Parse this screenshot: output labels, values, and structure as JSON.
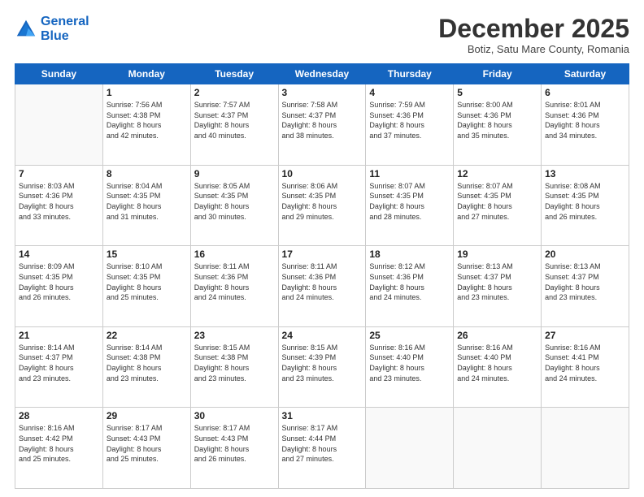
{
  "header": {
    "logo_line1": "General",
    "logo_line2": "Blue",
    "month": "December 2025",
    "location": "Botiz, Satu Mare County, Romania"
  },
  "weekdays": [
    "Sunday",
    "Monday",
    "Tuesday",
    "Wednesday",
    "Thursday",
    "Friday",
    "Saturday"
  ],
  "weeks": [
    [
      {
        "day": "",
        "info": ""
      },
      {
        "day": "1",
        "info": "Sunrise: 7:56 AM\nSunset: 4:38 PM\nDaylight: 8 hours\nand 42 minutes."
      },
      {
        "day": "2",
        "info": "Sunrise: 7:57 AM\nSunset: 4:37 PM\nDaylight: 8 hours\nand 40 minutes."
      },
      {
        "day": "3",
        "info": "Sunrise: 7:58 AM\nSunset: 4:37 PM\nDaylight: 8 hours\nand 38 minutes."
      },
      {
        "day": "4",
        "info": "Sunrise: 7:59 AM\nSunset: 4:36 PM\nDaylight: 8 hours\nand 37 minutes."
      },
      {
        "day": "5",
        "info": "Sunrise: 8:00 AM\nSunset: 4:36 PM\nDaylight: 8 hours\nand 35 minutes."
      },
      {
        "day": "6",
        "info": "Sunrise: 8:01 AM\nSunset: 4:36 PM\nDaylight: 8 hours\nand 34 minutes."
      }
    ],
    [
      {
        "day": "7",
        "info": "Sunrise: 8:03 AM\nSunset: 4:36 PM\nDaylight: 8 hours\nand 33 minutes."
      },
      {
        "day": "8",
        "info": "Sunrise: 8:04 AM\nSunset: 4:35 PM\nDaylight: 8 hours\nand 31 minutes."
      },
      {
        "day": "9",
        "info": "Sunrise: 8:05 AM\nSunset: 4:35 PM\nDaylight: 8 hours\nand 30 minutes."
      },
      {
        "day": "10",
        "info": "Sunrise: 8:06 AM\nSunset: 4:35 PM\nDaylight: 8 hours\nand 29 minutes."
      },
      {
        "day": "11",
        "info": "Sunrise: 8:07 AM\nSunset: 4:35 PM\nDaylight: 8 hours\nand 28 minutes."
      },
      {
        "day": "12",
        "info": "Sunrise: 8:07 AM\nSunset: 4:35 PM\nDaylight: 8 hours\nand 27 minutes."
      },
      {
        "day": "13",
        "info": "Sunrise: 8:08 AM\nSunset: 4:35 PM\nDaylight: 8 hours\nand 26 minutes."
      }
    ],
    [
      {
        "day": "14",
        "info": "Sunrise: 8:09 AM\nSunset: 4:35 PM\nDaylight: 8 hours\nand 26 minutes."
      },
      {
        "day": "15",
        "info": "Sunrise: 8:10 AM\nSunset: 4:35 PM\nDaylight: 8 hours\nand 25 minutes."
      },
      {
        "day": "16",
        "info": "Sunrise: 8:11 AM\nSunset: 4:36 PM\nDaylight: 8 hours\nand 24 minutes."
      },
      {
        "day": "17",
        "info": "Sunrise: 8:11 AM\nSunset: 4:36 PM\nDaylight: 8 hours\nand 24 minutes."
      },
      {
        "day": "18",
        "info": "Sunrise: 8:12 AM\nSunset: 4:36 PM\nDaylight: 8 hours\nand 24 minutes."
      },
      {
        "day": "19",
        "info": "Sunrise: 8:13 AM\nSunset: 4:37 PM\nDaylight: 8 hours\nand 23 minutes."
      },
      {
        "day": "20",
        "info": "Sunrise: 8:13 AM\nSunset: 4:37 PM\nDaylight: 8 hours\nand 23 minutes."
      }
    ],
    [
      {
        "day": "21",
        "info": "Sunrise: 8:14 AM\nSunset: 4:37 PM\nDaylight: 8 hours\nand 23 minutes."
      },
      {
        "day": "22",
        "info": "Sunrise: 8:14 AM\nSunset: 4:38 PM\nDaylight: 8 hours\nand 23 minutes."
      },
      {
        "day": "23",
        "info": "Sunrise: 8:15 AM\nSunset: 4:38 PM\nDaylight: 8 hours\nand 23 minutes."
      },
      {
        "day": "24",
        "info": "Sunrise: 8:15 AM\nSunset: 4:39 PM\nDaylight: 8 hours\nand 23 minutes."
      },
      {
        "day": "25",
        "info": "Sunrise: 8:16 AM\nSunset: 4:40 PM\nDaylight: 8 hours\nand 23 minutes."
      },
      {
        "day": "26",
        "info": "Sunrise: 8:16 AM\nSunset: 4:40 PM\nDaylight: 8 hours\nand 24 minutes."
      },
      {
        "day": "27",
        "info": "Sunrise: 8:16 AM\nSunset: 4:41 PM\nDaylight: 8 hours\nand 24 minutes."
      }
    ],
    [
      {
        "day": "28",
        "info": "Sunrise: 8:16 AM\nSunset: 4:42 PM\nDaylight: 8 hours\nand 25 minutes."
      },
      {
        "day": "29",
        "info": "Sunrise: 8:17 AM\nSunset: 4:43 PM\nDaylight: 8 hours\nand 25 minutes."
      },
      {
        "day": "30",
        "info": "Sunrise: 8:17 AM\nSunset: 4:43 PM\nDaylight: 8 hours\nand 26 minutes."
      },
      {
        "day": "31",
        "info": "Sunrise: 8:17 AM\nSunset: 4:44 PM\nDaylight: 8 hours\nand 27 minutes."
      },
      {
        "day": "",
        "info": ""
      },
      {
        "day": "",
        "info": ""
      },
      {
        "day": "",
        "info": ""
      }
    ]
  ]
}
